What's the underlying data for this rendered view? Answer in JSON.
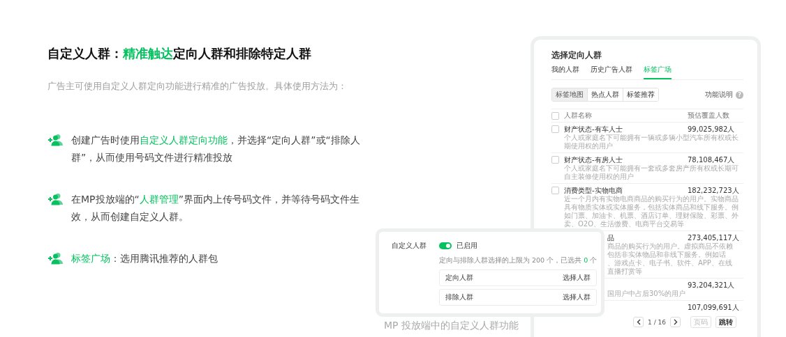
{
  "intro": {
    "title_parts": [
      {
        "text": "自定义人群：",
        "highlight": false
      },
      {
        "text": "精准触达",
        "highlight": true
      },
      {
        "text": "定向人群和排除特定人群",
        "highlight": false
      }
    ],
    "subtitle": "广告主可使用自定义人群定向功能进行精准的广告投放。具体使用方法为：",
    "steps": [
      {
        "parts": [
          {
            "text": "创建广告时使用",
            "highlight": false
          },
          {
            "text": "自定义人群定向功能",
            "highlight": true
          },
          {
            "text": "，并选择“定向人群”或“排除人群”，从而使用号码文件进行精准投放",
            "highlight": false
          }
        ]
      },
      {
        "parts": [
          {
            "text": "在MP投放端的“",
            "highlight": false
          },
          {
            "text": "人群管理",
            "highlight": true
          },
          {
            "text": "”界面内上传号码文件，并等待号码文件生效，从而创建自定义人群。",
            "highlight": false
          }
        ]
      },
      {
        "parts": [
          {
            "text": "标签广场",
            "highlight": true
          },
          {
            "text": "：选用腾讯推荐的人群包",
            "highlight": false
          }
        ]
      }
    ]
  },
  "selector": {
    "title": "选择定向人群",
    "tabs": [
      {
        "label": "我的人群",
        "selected": false
      },
      {
        "label": "历史广告人群",
        "selected": false
      },
      {
        "label": "标签广场",
        "selected": true
      }
    ],
    "segments": [
      {
        "label": "标签地图",
        "selected": true
      },
      {
        "label": "热点人群",
        "selected": false
      },
      {
        "label": "标签推荐",
        "selected": false
      }
    ],
    "help_label": "功能说明",
    "help_icon": "?",
    "columns": [
      "人群名称",
      "预估覆盖人数"
    ],
    "header_checked": false,
    "rows": [
      {
        "kind": "full",
        "checked": false,
        "name": "财产状态-有车人士",
        "description": "个人或家庭名下可能拥有一辆或多辆小型汽车所有权或长期使用权的用户",
        "count": "99,025,982人"
      },
      {
        "kind": "full",
        "checked": false,
        "name": "财产状态-有房人士",
        "description": "个人或家庭名下可能拥有一套或多套房产所有权或长期可自主装修使用权的用户",
        "count": "78,108,467人"
      },
      {
        "kind": "full",
        "checked": false,
        "name": "消费类型-实物电商",
        "description": "近一个月内有实物电商商品的购买行为的用户。实物商品具有物质实体或实体服务，包括实体商品和线下服务。例如门票、加油卡、机票、酒店订单、理财保险、彩票、外卖、O2O、生活缴费、电商平台交易等",
        "count": "182,232,723人"
      },
      {
        "kind": "covered",
        "name": "品",
        "lines": [
          "商品的购买行为的用户。虚拟商品不依赖",
          "包括非实体物品和非线下服务。例如话",
          "、游戏点卡、电子书、软件、APP、在线",
          "直播打赏等"
        ],
        "count": "273,405,117人"
      },
      {
        "kind": "covered",
        "lines": [
          "国用户中占后30%的用户"
        ],
        "count": "93,204,321人"
      },
      {
        "kind": "covered",
        "count": "107,099,691人"
      }
    ],
    "pagination": {
      "page": "1 / 16",
      "page_placeholder": "页码",
      "jump": "跳转"
    }
  },
  "overlay": {
    "label": "自定义人群",
    "toggle": {
      "on": true,
      "label": "已启用"
    },
    "hint_parts": [
      {
        "text": "定向与排除人群选择的上限为 200 个，已选共 ",
        "highlight": false
      },
      {
        "text": "0",
        "highlight": true
      },
      {
        "text": " 个",
        "highlight": false
      }
    ],
    "rows": [
      {
        "label": "定向人群",
        "action": "选择人群"
      },
      {
        "label": "排除人群",
        "action": "选择人群"
      }
    ]
  },
  "caption": "MP 投放端中的自定义人群功能"
}
